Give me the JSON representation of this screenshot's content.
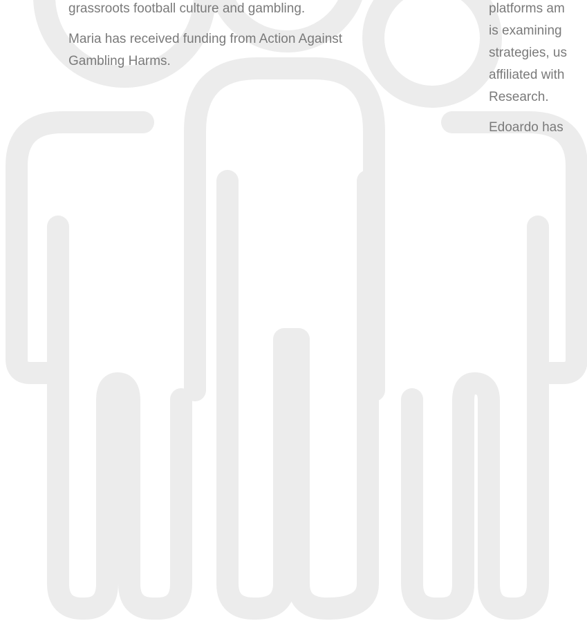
{
  "left_bio": {
    "line1": "grassroots football culture and gambling.",
    "funding_line1": "Maria has received funding from Action Against",
    "funding_line2": "Gambling Harms."
  },
  "right_bio": {
    "line1": "platforms am",
    "line2": "is examining",
    "line3": "strategies, us",
    "line4": "affiliated with",
    "line5": "Research.",
    "funding_line1": "Edoardo has"
  },
  "illustration": {
    "icon": "group-of-people-icon",
    "color": "#ececec"
  }
}
